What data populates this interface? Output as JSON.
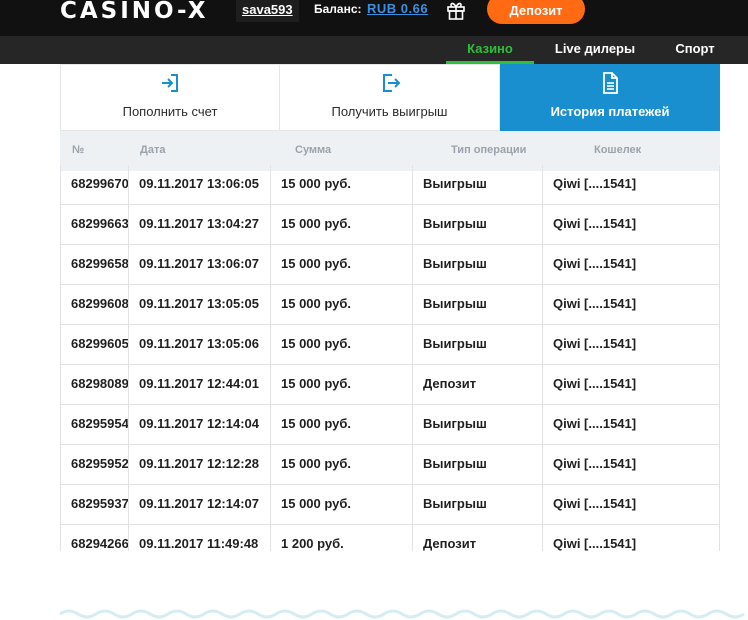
{
  "header": {
    "logo": "CASINO-X",
    "username": "sava593",
    "balance_label": "Баланс:",
    "balance_value": "RUB 0.66",
    "deposit_label": "Депозит",
    "gift_icon": "gift-icon"
  },
  "nav": {
    "items": [
      {
        "label": "Казино",
        "active": true
      },
      {
        "label": "Live дилеры",
        "active": false
      },
      {
        "label": "Спорт",
        "active": false
      }
    ]
  },
  "tabs": [
    {
      "label": "Пополнить счет",
      "icon": "login-arrow-icon",
      "active": false
    },
    {
      "label": "Получить выигрыш",
      "icon": "logout-arrow-icon",
      "active": false
    },
    {
      "label": "История платежей",
      "icon": "document-icon",
      "active": true
    }
  ],
  "table": {
    "columns": [
      "№",
      "Дата",
      "Сумма",
      "Тип операции",
      "Кошелек"
    ],
    "rows": [
      {
        "id": "68299670",
        "date": "09.11.2017 13:06:05",
        "sum": "15 000 руб.",
        "type": "Выигрыш",
        "wallet": "Qiwi [....1541]"
      },
      {
        "id": "68299663",
        "date": "09.11.2017 13:04:27",
        "sum": "15 000 руб.",
        "type": "Выигрыш",
        "wallet": "Qiwi [....1541]"
      },
      {
        "id": "68299658",
        "date": "09.11.2017 13:06:07",
        "sum": "15 000 руб.",
        "type": "Выигрыш",
        "wallet": "Qiwi [....1541]"
      },
      {
        "id": "68299608",
        "date": "09.11.2017 13:05:05",
        "sum": "15 000 руб.",
        "type": "Выигрыш",
        "wallet": "Qiwi [....1541]"
      },
      {
        "id": "68299605",
        "date": "09.11.2017 13:05:06",
        "sum": "15 000 руб.",
        "type": "Выигрыш",
        "wallet": "Qiwi [....1541]"
      },
      {
        "id": "68298089",
        "date": "09.11.2017 12:44:01",
        "sum": "15 000 руб.",
        "type": "Депозит",
        "wallet": "Qiwi [....1541]"
      },
      {
        "id": "68295954",
        "date": "09.11.2017 12:14:04",
        "sum": "15 000 руб.",
        "type": "Выигрыш",
        "wallet": "Qiwi [....1541]"
      },
      {
        "id": "68295952",
        "date": "09.11.2017 12:12:28",
        "sum": "15 000 руб.",
        "type": "Выигрыш",
        "wallet": "Qiwi [....1541]"
      },
      {
        "id": "68295937",
        "date": "09.11.2017 12:14:07",
        "sum": "15 000 руб.",
        "type": "Выигрыш",
        "wallet": "Qiwi [....1541]"
      },
      {
        "id": "68294266",
        "date": "09.11.2017 11:49:48",
        "sum": "1 200 руб.",
        "type": "Депозит",
        "wallet": "Qiwi [....1541]"
      }
    ]
  },
  "colors": {
    "accent_blue": "#1a8fd0",
    "nav_active_green": "#2fbf3a",
    "deposit_orange": "#ff6a12",
    "balance_link": "#3b8fe0",
    "header_bg": "#111111",
    "wave": "#d5ecf2"
  }
}
